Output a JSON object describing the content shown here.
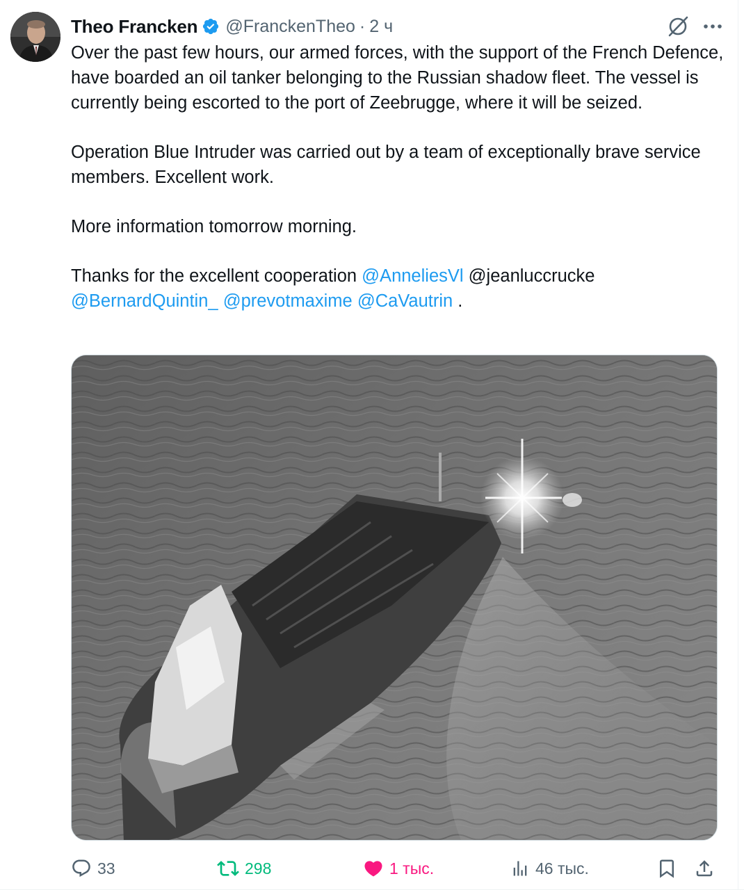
{
  "author": {
    "name": "Theo Francken",
    "handle": "@FranckenTheo",
    "separator": "·",
    "time": "2 ч",
    "verified": true,
    "verified_color": "#1d9bf0"
  },
  "header_icons": [
    "grok-icon",
    "more-icon"
  ],
  "text": {
    "p1": "Over the past few hours, our armed forces, with the support of the French Defence, have boarded an oil tanker belonging to the Russian shadow fleet. The vessel is currently being escorted to the port of Zeebrugge, where it will be seized.",
    "p2": "Operation Blue Intruder was carried out by a team of exceptionally brave service members. Excellent work.",
    "p3": "More information tomorrow morning.",
    "p4_prefix": "Thanks for the excellent cooperation",
    "mentions": [
      "@AnneliesVl",
      "@jeanluccrucke",
      "@BernardQuintin_",
      "@prevotmaxime",
      "@CaVautrin"
    ],
    "p4_suffix": "."
  },
  "actions": {
    "replies": "33",
    "reposts": "298",
    "likes": "1 тыс.",
    "views": "46 тыс."
  },
  "colors": {
    "mention": "#1d9bf0",
    "repost_active": "#00ba7c",
    "like_active": "#f91880",
    "muted": "#536471"
  }
}
